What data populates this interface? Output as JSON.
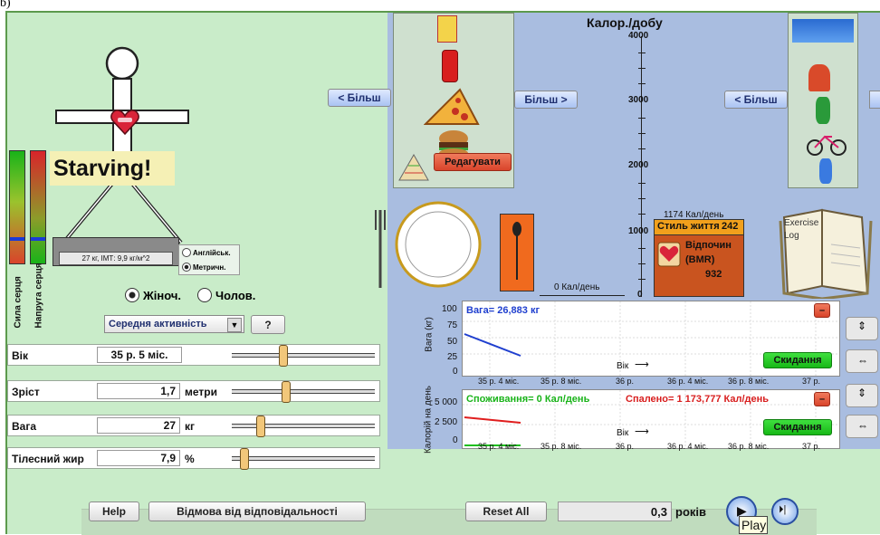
{
  "corner_mark": "b)",
  "figure": {
    "condition": "Starving!",
    "scale_readout": "27 кг, ІМТ: 9,9 кг/м^2"
  },
  "units": {
    "english": "Англійськ.",
    "metric": "Метричн.",
    "selected": "metric"
  },
  "bars": {
    "left_label": "Сила серця",
    "right_label": "Напруга серця",
    "left_level_pct": 22,
    "right_level_pct": 22
  },
  "gender": {
    "female": "Жіноч.",
    "male": "Чолов.",
    "selected": "female"
  },
  "activity": {
    "value": "Середня активність",
    "help": "?"
  },
  "inputs": {
    "age": {
      "label": "Вік",
      "value": "35 р. 5 міс.",
      "slider_pct": 36
    },
    "height": {
      "label": "Зріст",
      "value": "1,7",
      "unit": "метри",
      "slider_pct": 38
    },
    "weight": {
      "label": "Вага",
      "value": "27",
      "unit": "кг",
      "slider_pct": 20
    },
    "bodyfat": {
      "label": "Тілесний жир",
      "value": "7,9",
      "unit": "%",
      "slider_pct": 9
    }
  },
  "food": {
    "more_left": "< Більш",
    "more_right": "Більш >",
    "edit": "Редагувати",
    "plate_label": "0 Кал/день"
  },
  "exercise": {
    "more_left": "< Більш",
    "book": "Exercise Log"
  },
  "calorie_axis": {
    "title": "Калор./добу",
    "ticks": [
      "4000",
      "3000",
      "2000",
      "1000",
      "0"
    ],
    "lifestyle_label": "1174 Кал/день",
    "lifestyle_title": "Стиль життя",
    "lifestyle_value": "242",
    "bmr_label": "Відпочин (BMR)",
    "bmr_value": "932"
  },
  "weight_graph": {
    "title": "Вага= 26,883 кг",
    "ylabel": "Вага (кг)",
    "yticks": [
      "100",
      "75",
      "50",
      "25",
      "0"
    ],
    "xticks": [
      "35 р. 4 міс.",
      "35 р. 8 міс.",
      "36 р.",
      "36 р. 4 міс.",
      "36 р. 8 міс.",
      "37 р."
    ],
    "x_axis": "Вік",
    "reset": "Скидання"
  },
  "cal_graph": {
    "intake": "Споживання= 0 Кал/день",
    "burned": "Спалено= 1 173,777 Кал/день",
    "ylabel": "Калорій на день",
    "yticks": [
      "5 000",
      "2 500",
      "0"
    ],
    "xticks": [
      "35 р. 4 міс.",
      "35 р. 8 міс.",
      "36 р.",
      "36 р. 4 міс.",
      "36 р. 8 міс.",
      "37 р."
    ],
    "x_axis": "Вік",
    "reset": "Скидання"
  },
  "bottom": {
    "help": "Help",
    "disclaimer": "Відмова від відповідальності",
    "reset_all": "Reset All",
    "time_value": "0,3",
    "time_unit": "років",
    "tooltip": "Play"
  },
  "colors": {
    "panel_green": "#c9ecc9",
    "panel_blue": "#a9bde0",
    "weight_line": "#1f3fcf",
    "burned_line": "#e01e1e",
    "intake_line": "#1fbf1f"
  }
}
